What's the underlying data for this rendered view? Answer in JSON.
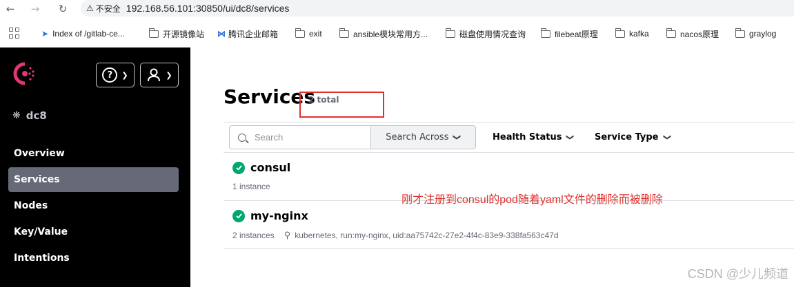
{
  "browser": {
    "security_label": "不安全",
    "url": "192.168.56.101:30850/ui/dc8/services"
  },
  "bookmarks": [
    {
      "label": "Index of /gitlab-ce...",
      "icon": "gitlab-icon"
    },
    {
      "label": "开源镜像站",
      "icon": "folder-icon"
    },
    {
      "label": "腾讯企业邮箱",
      "icon": "mail-icon"
    },
    {
      "label": "exit",
      "icon": "folder-icon"
    },
    {
      "label": "ansible模块常用方...",
      "icon": "folder-icon"
    },
    {
      "label": "磁盘使用情况查询",
      "icon": "folder-icon"
    },
    {
      "label": "filebeat原理",
      "icon": "folder-icon"
    },
    {
      "label": "kafka",
      "icon": "folder-icon"
    },
    {
      "label": "nacos原理",
      "icon": "folder-icon"
    },
    {
      "label": "graylog",
      "icon": "folder-icon"
    }
  ],
  "sidebar": {
    "datacenter": "dc8",
    "items": [
      {
        "label": "Overview",
        "active": false
      },
      {
        "label": "Services",
        "active": true
      },
      {
        "label": "Nodes",
        "active": false
      },
      {
        "label": "Key/Value",
        "active": false
      },
      {
        "label": "Intentions",
        "active": false
      }
    ]
  },
  "main": {
    "title": "Services",
    "total": "2 total",
    "search_placeholder": "Search",
    "search_across": "Search Across",
    "health_status": "Health Status",
    "service_type": "Service Type",
    "services": [
      {
        "name": "consul",
        "instances": "1 instance",
        "tags": ""
      },
      {
        "name": "my-nginx",
        "instances": "2 instances",
        "tags": "kubernetes, run:my-nginx, uid:aa75742c-27e2-4f4c-83e9-338fa563c47d"
      }
    ]
  },
  "annotation": "刚才注册到consul的pod随着yaml文件的删除而被删除",
  "watermark": "CSDN @少儿频道",
  "colors": {
    "sidebar_bg": "#000000",
    "active_nav": "#656a76",
    "passing": "#00a86b",
    "annotation": "#e0302c",
    "logo": "#e03875"
  }
}
